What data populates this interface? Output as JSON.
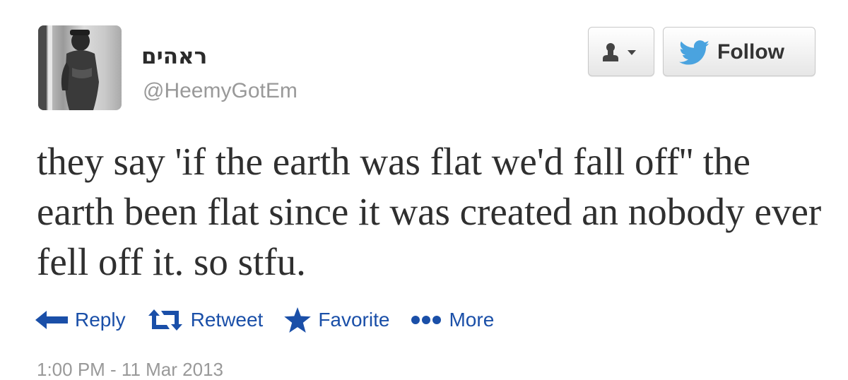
{
  "tweet": {
    "display_name": "ראהים",
    "handle": "@HeemyGotEm",
    "text": "they say 'if the earth was flat we'd fall off'' the earth been flat since it was created an nobody ever fell off it. so stfu.",
    "timestamp": "1:00 PM - 11 Mar 2013"
  },
  "header": {
    "user_menu_icon": "user-icon",
    "follow_icon": "twitter-bird-icon",
    "follow_label": "Follow"
  },
  "actions": [
    {
      "label": "Reply",
      "icon": "reply-icon"
    },
    {
      "label": "Retweet",
      "icon": "retweet-icon"
    },
    {
      "label": "Favorite",
      "icon": "star-icon"
    },
    {
      "label": "More",
      "icon": "more-dots-icon"
    }
  ],
  "colors": {
    "action_blue": "#1a4fa8",
    "twitter_bird": "#4aa3df",
    "text": "#2f2f2f",
    "muted": "#999999"
  }
}
